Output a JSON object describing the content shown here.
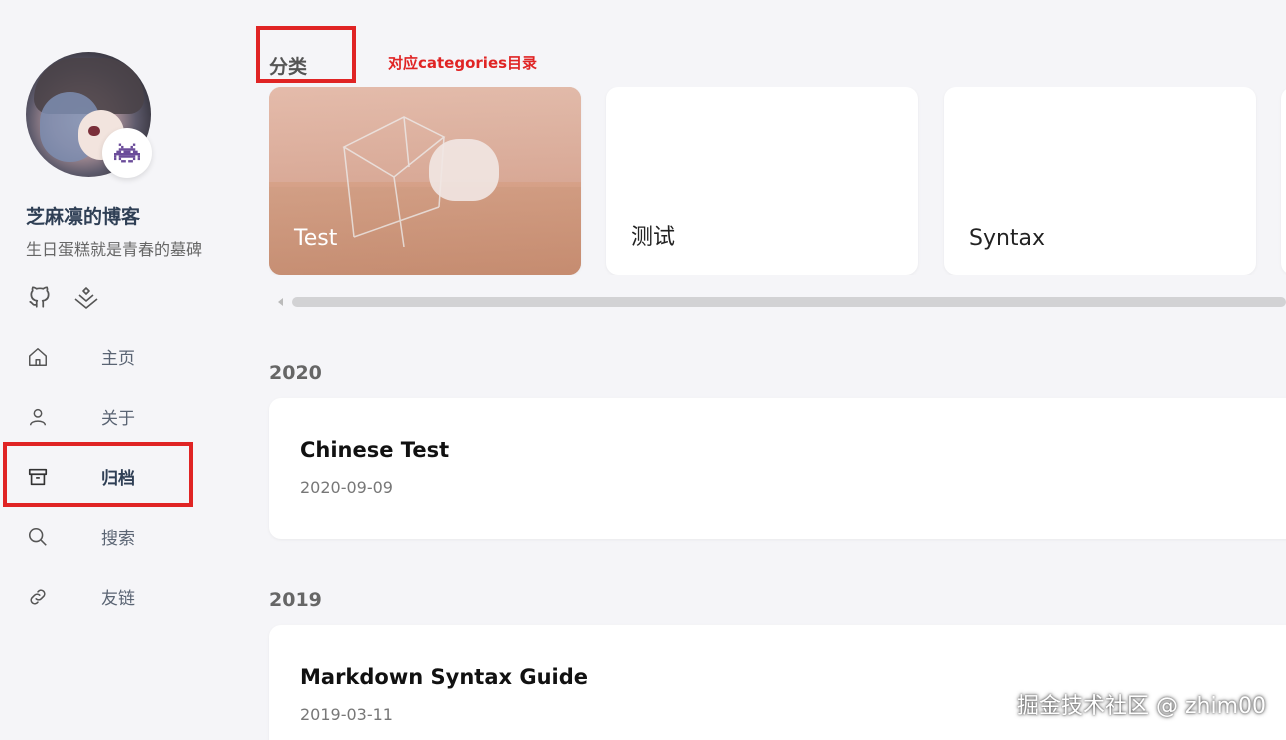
{
  "sidebar": {
    "site_name": "芝麻凛的博客",
    "site_subtitle": "生日蛋糕就是青春的墓碑",
    "social": [
      {
        "icon": "github-icon"
      },
      {
        "icon": "juejin-icon"
      }
    ],
    "nav": [
      {
        "label": "主页",
        "icon": "home-icon"
      },
      {
        "label": "关于",
        "icon": "user-icon"
      },
      {
        "label": "归档",
        "icon": "archive-icon",
        "active": true
      },
      {
        "label": "搜索",
        "icon": "search-icon"
      },
      {
        "label": "友链",
        "icon": "link-icon"
      }
    ]
  },
  "main": {
    "section_title": "分类",
    "annotation": "对应categories目录",
    "categories": [
      {
        "label": "Test",
        "has_image": true
      },
      {
        "label": "测试"
      },
      {
        "label": "Syntax"
      }
    ],
    "archive": [
      {
        "year": "2020",
        "posts": [
          {
            "title": "Chinese Test",
            "date": "2020-09-09"
          }
        ]
      },
      {
        "year": "2019",
        "posts": [
          {
            "title": "Markdown Syntax Guide",
            "date": "2019-03-11"
          }
        ]
      }
    ]
  },
  "watermark": "掘金技术社区 @ zhim00",
  "colors": {
    "accent_red": "#e02424",
    "background": "#f5f5f8",
    "badge_icon": "#6b4c9a"
  }
}
